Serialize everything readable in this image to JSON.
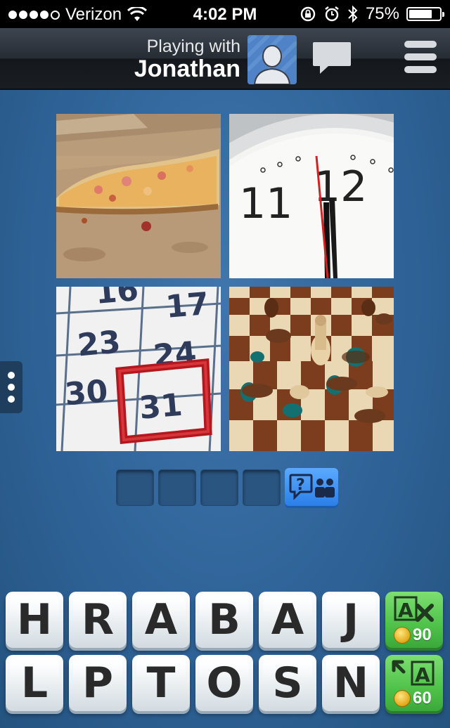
{
  "status": {
    "carrier": "Verizon",
    "time": "4:02 PM",
    "battery": "75%",
    "battery_level": 0.75,
    "signal_bars": 4,
    "signal_total": 5
  },
  "header": {
    "playing_with_label": "Playing with",
    "opponent_name": "Jonathan",
    "avatar_icon": "person-avatar-icon",
    "chat_icon": "chat-bubble-icon",
    "menu_icon": "hamburger-menu-icon"
  },
  "puzzle": {
    "images": [
      "pizza-slice-photo",
      "clock-near-twelve-photo",
      "calendar-31-photo",
      "chess-pieces-photo"
    ],
    "calendar_numbers": [
      "16",
      "17",
      "23",
      "24",
      "30",
      "31"
    ],
    "clock_numbers": [
      "11",
      "12"
    ],
    "answer_slots": 4,
    "help_icon": "ask-friends-icon"
  },
  "keyboard": {
    "row1": [
      "H",
      "R",
      "A",
      "B",
      "A",
      "J"
    ],
    "row2": [
      "L",
      "P",
      "T",
      "O",
      "S",
      "N"
    ]
  },
  "powerups": {
    "remove_letters_cost": "90",
    "reveal_letter_cost": "60",
    "accent_green": "#4fc24a"
  }
}
